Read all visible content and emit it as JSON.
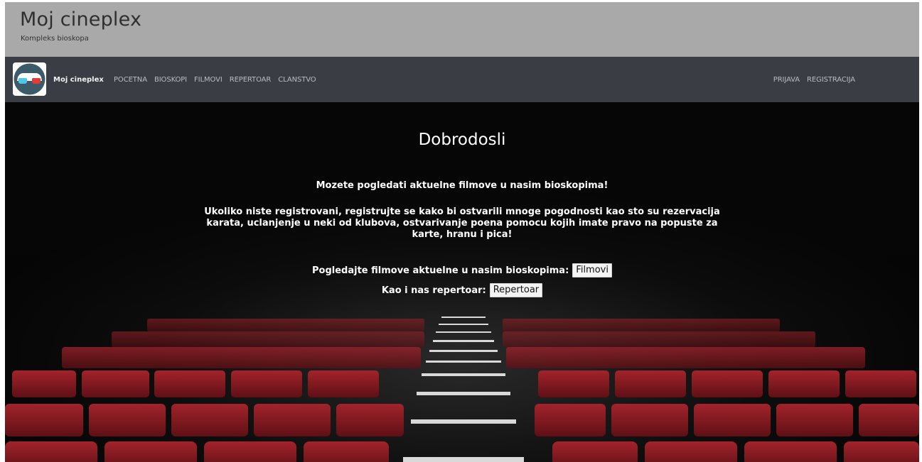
{
  "header": {
    "title": "Moj cineplex",
    "subtitle": "Kompleks bioskopa"
  },
  "navbar": {
    "brand": "Moj cineplex",
    "logo_icon": "3d-glasses-icon",
    "left_links": [
      "POCETNA",
      "BIOSKOPI",
      "FILMOVI",
      "REPERTOAR",
      "CLANSTVO"
    ],
    "right_links": [
      "PRIJAVA",
      "REGISTRACIJA"
    ]
  },
  "hero": {
    "title": "Dobrodosli",
    "intro": "Mozete pogledati aktuelne filmove u nasim bioskopima!",
    "paragraph": "Ukoliko niste registrovani, registrujte se kako bi ostvarili mnoge pogodnosti kao sto su rezervacija karata, uclanjenje u neki od klubova, ostvarivanje poena pomocu kojih imate pravo na popuste za karte, hranu i pica!",
    "cta_movies_text": "Pogledajte filmove aktuelne u nasim bioskopima:",
    "cta_movies_button": "Filmovi",
    "cta_repertoire_text": "Kao i nas repertoar:",
    "cta_repertoire_button": "Repertoar"
  },
  "colors": {
    "header_bg": "#a9a9a9",
    "navbar_bg": "#3a3e44",
    "seat_red": "#8e1b22",
    "hero_bg": "#060606"
  }
}
